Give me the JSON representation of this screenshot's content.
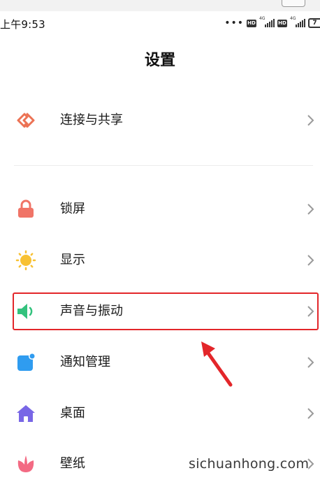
{
  "status_bar": {
    "time": "上午9:53",
    "dots": "•••",
    "hd_label": "HD",
    "network_label": "4G",
    "battery_text": "7"
  },
  "page": {
    "title": "设置"
  },
  "settings_items": [
    {
      "label": "连接与共享",
      "icon": "connection-share-icon",
      "color": "#ec7254"
    },
    {
      "label": "锁屏",
      "icon": "lock-icon",
      "color": "#f07467"
    },
    {
      "label": "显示",
      "icon": "sun-icon",
      "color": "#f8c132"
    },
    {
      "label": "声音与振动",
      "icon": "speaker-icon",
      "color": "#33c27d"
    },
    {
      "label": "通知管理",
      "icon": "notification-icon",
      "color": "#2f9cf0"
    },
    {
      "label": "桌面",
      "icon": "home-icon",
      "color": "#7866e6"
    },
    {
      "label": "壁纸",
      "icon": "flower-icon",
      "color": "#f36a83"
    }
  ],
  "annotation": {
    "highlighted_item": "声音与振动",
    "color": "#e3262a"
  },
  "watermark": "sichuanhong.com"
}
